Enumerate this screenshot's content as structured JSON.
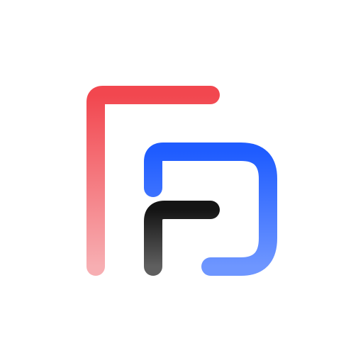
{
  "logo": {
    "name": "app-logo",
    "colors": {
      "background": "#ffffff",
      "red_stroke_top": "#f2474f",
      "red_stroke_bottom": "#f7aeb2",
      "blue_stroke_top": "#1f5cff",
      "blue_stroke_bottom": "#6e96ff",
      "black_stroke_top": "#141414",
      "black_stroke_bottom": "#5f5f5f"
    }
  }
}
